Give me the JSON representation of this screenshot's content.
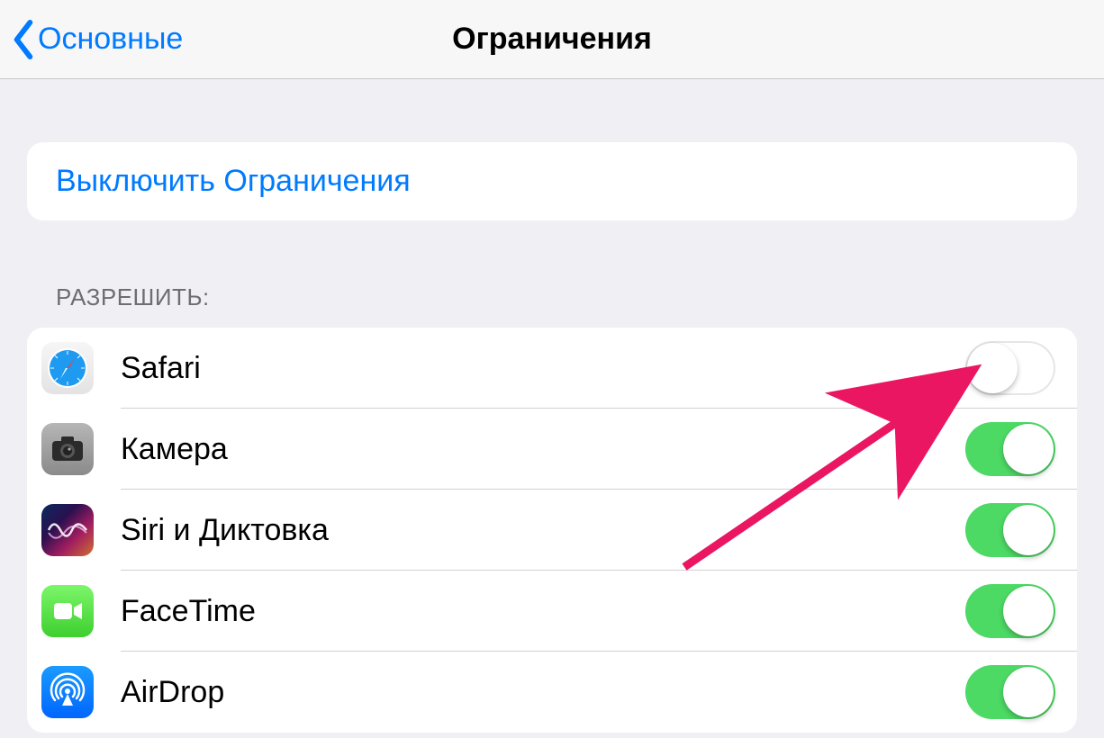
{
  "nav": {
    "back_label": "Основные",
    "title": "Ограничения"
  },
  "actions": {
    "disable_restrictions": "Выключить Ограничения"
  },
  "section_allow_header": "РАЗРЕШИТЬ:",
  "apps": [
    {
      "id": "safari",
      "label": "Safari",
      "icon": "safari-icon",
      "enabled": false
    },
    {
      "id": "camera",
      "label": "Камера",
      "icon": "camera-icon",
      "enabled": true
    },
    {
      "id": "siri",
      "label": "Siri и Диктовка",
      "icon": "siri-icon",
      "enabled": true
    },
    {
      "id": "facetime",
      "label": "FaceTime",
      "icon": "facetime-icon",
      "enabled": true
    },
    {
      "id": "airdrop",
      "label": "AirDrop",
      "icon": "airdrop-icon",
      "enabled": true
    }
  ],
  "colors": {
    "accent": "#007aff",
    "toggle_on": "#4cd964",
    "annotation": "#ea1661"
  }
}
